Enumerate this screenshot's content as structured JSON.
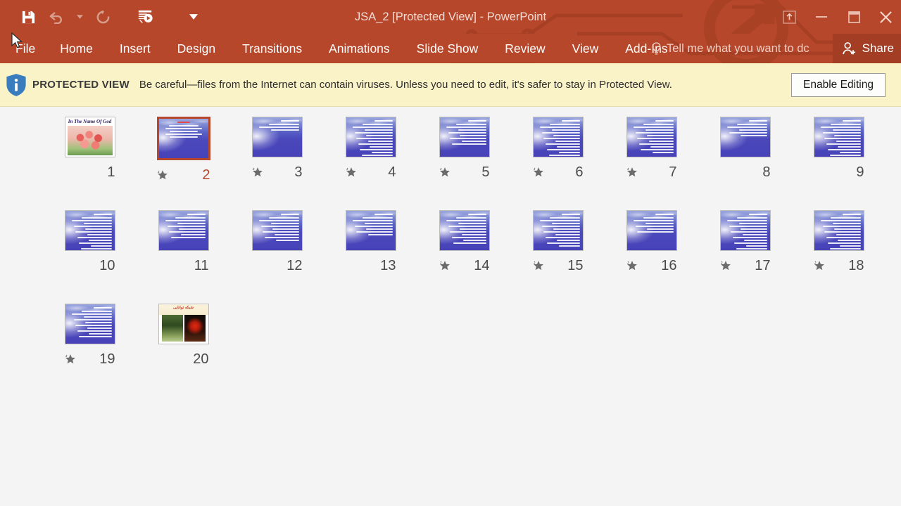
{
  "window": {
    "title": "JSA_2 [Protected View] - PowerPoint",
    "quick_access": [
      {
        "name": "save-icon",
        "label": "Save"
      },
      {
        "name": "undo-icon",
        "label": "Undo"
      },
      {
        "name": "undo-dropdown-icon",
        "label": "Undo options"
      },
      {
        "name": "redo-icon",
        "label": "Redo"
      },
      {
        "name": "start-slideshow-icon",
        "label": "Start From Beginning"
      },
      {
        "name": "customize-qat-icon",
        "label": "Customize Quick Access Toolbar"
      }
    ],
    "controls": {
      "ribbon_display": "Ribbon Display Options",
      "minimize": "Minimize",
      "restore": "Restore Down",
      "close": "Close"
    }
  },
  "ribbon": {
    "tabs": [
      {
        "label": "File"
      },
      {
        "label": "Home"
      },
      {
        "label": "Insert"
      },
      {
        "label": "Design"
      },
      {
        "label": "Transitions"
      },
      {
        "label": "Animations"
      },
      {
        "label": "Slide Show"
      },
      {
        "label": "Review"
      },
      {
        "label": "View"
      },
      {
        "label": "Add-Ins"
      }
    ],
    "tell_me": "Tell me what you want to dc",
    "share": "Share"
  },
  "protected_view": {
    "label": "PROTECTED VIEW",
    "message": "Be careful—files from the Internet can contain viruses. Unless you need to edit, it's safer to stay in Protected View.",
    "button": "Enable Editing"
  },
  "colors": {
    "ribbon": "#b7472a",
    "banner_bg": "#faf3c8",
    "selection": "#b7472a",
    "workspace": "#f4f4f4",
    "slide_number": "#4a4a4a"
  },
  "slides": [
    {
      "number": "9",
      "star": false,
      "kind": "text",
      "lines": 14,
      "selected": false
    },
    {
      "number": "8",
      "star": false,
      "kind": "text",
      "lines": 6,
      "selected": false
    },
    {
      "number": "7",
      "star": true,
      "kind": "text",
      "lines": 12,
      "selected": false
    },
    {
      "number": "6",
      "star": true,
      "kind": "text",
      "lines": 13,
      "selected": false
    },
    {
      "number": "5",
      "star": true,
      "kind": "text",
      "lines": 9,
      "selected": false
    },
    {
      "number": "4",
      "star": true,
      "kind": "text",
      "lines": 13,
      "selected": false
    },
    {
      "number": "3",
      "star": true,
      "kind": "text",
      "lines": 4,
      "selected": false
    },
    {
      "number": "2",
      "star": true,
      "kind": "center",
      "lines": 6,
      "selected": true
    },
    {
      "number": "1",
      "star": false,
      "kind": "tulips",
      "title": "In The Name Of God",
      "selected": false
    },
    {
      "number": "18",
      "star": true,
      "kind": "text",
      "lines": 14,
      "selected": false
    },
    {
      "number": "17",
      "star": true,
      "kind": "text",
      "lines": 13,
      "selected": false
    },
    {
      "number": "16",
      "star": true,
      "kind": "text",
      "lines": 7,
      "selected": false
    },
    {
      "number": "15",
      "star": true,
      "kind": "text",
      "lines": 12,
      "selected": false
    },
    {
      "number": "14",
      "star": true,
      "kind": "text",
      "lines": 11,
      "selected": false
    },
    {
      "number": "13",
      "star": false,
      "kind": "text",
      "lines": 8,
      "selected": false
    },
    {
      "number": "12",
      "star": false,
      "kind": "text",
      "lines": 10,
      "selected": false
    },
    {
      "number": "11",
      "star": false,
      "kind": "text",
      "lines": 9,
      "selected": false
    },
    {
      "number": "10",
      "star": false,
      "kind": "text",
      "lines": 13,
      "selected": false
    },
    {
      "number": "20",
      "star": false,
      "kind": "photos",
      "title": "شبکه توانایی",
      "selected": false
    },
    {
      "number": "19",
      "star": true,
      "kind": "text",
      "lines": 11,
      "selected": false
    }
  ]
}
